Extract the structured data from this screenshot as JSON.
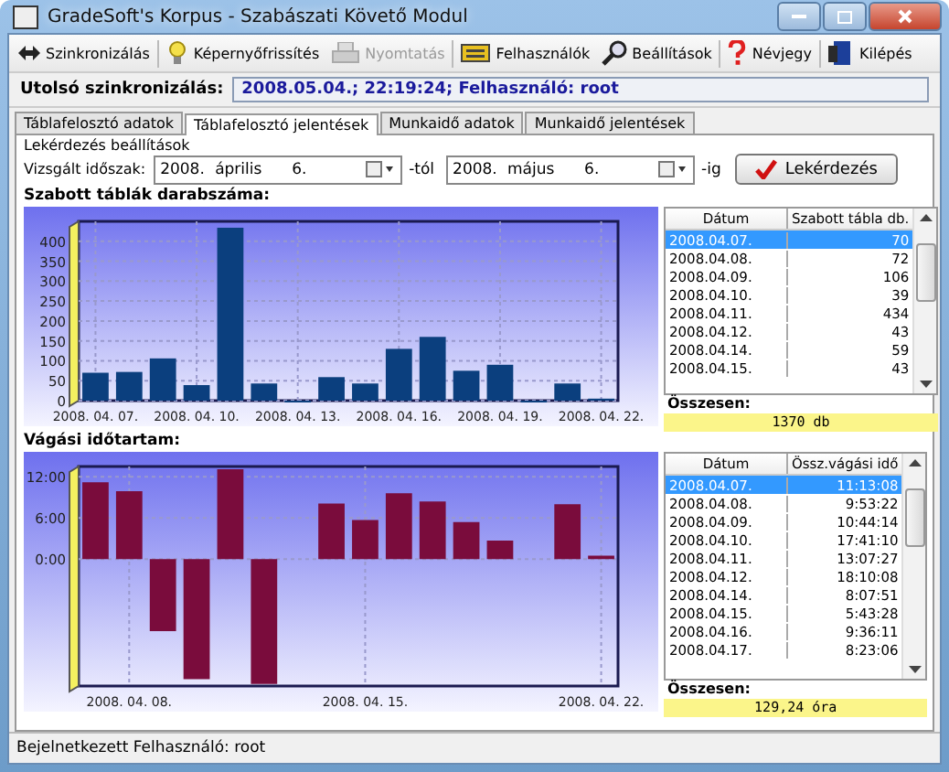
{
  "window": {
    "title": "GradeSoft's Korpus - Szabászati Követő Modul"
  },
  "toolbar": [
    {
      "label": "Szinkronizálás",
      "disabled": false
    },
    {
      "label": "Képernyőfrissítés",
      "disabled": false
    },
    {
      "label": "Nyomtatás",
      "disabled": true
    },
    {
      "label": "Felhasználók",
      "disabled": false
    },
    {
      "label": "Beállítások",
      "disabled": false
    },
    {
      "label": "Névjegy",
      "disabled": false
    },
    {
      "label": "Kilépés",
      "disabled": false
    }
  ],
  "sync": {
    "label": "Utolsó szinkronizálás:",
    "value": "2008.05.04.; 22:19:24; Felhasználó: root"
  },
  "tabs": [
    {
      "label": "Táblafelosztó adatok",
      "selected": false
    },
    {
      "label": "Táblafelosztó jelentések",
      "selected": true
    },
    {
      "label": "Munkaidő adatok",
      "selected": false
    },
    {
      "label": "Munkaidő jelentések",
      "selected": false
    }
  ],
  "query": {
    "group_label": "Lekérdezés beállítások",
    "period_label": "Vizsgált időszak:",
    "from": {
      "year": "2008.",
      "month": "április",
      "day": "6."
    },
    "from_suffix": "-tól",
    "to": {
      "year": "2008.",
      "month": "május",
      "day": "6."
    },
    "to_suffix": "-ig",
    "button": "Lekérdezés"
  },
  "panels": [
    {
      "title": "Szabott táblák darabszáma:",
      "chart_data": {
        "type": "bar",
        "grid": true,
        "categories": [
          "2008. 04. 07.",
          null,
          null,
          "2008. 04. 10.",
          null,
          null,
          "2008. 04. 13.",
          null,
          null,
          "2008. 04. 16.",
          null,
          null,
          "2008. 04. 19.",
          null,
          null,
          "2008. 04. 22."
        ],
        "ylim": [
          0,
          450
        ],
        "yticks": [
          0,
          50,
          100,
          150,
          200,
          250,
          300,
          350,
          400
        ],
        "series": [
          {
            "color": "#0b3f7e",
            "values": [
              70,
              72,
              106,
              39,
              434,
              43,
              0,
              59,
              43,
              130,
              160,
              75,
              90,
              0,
              43,
              5
            ]
          }
        ]
      },
      "table": {
        "columns": [
          "Dátum",
          "Szabott tábla db."
        ],
        "rows": [
          {
            "cells": [
              "2008.04.07.",
              "70"
            ],
            "selected": true
          },
          {
            "cells": [
              "2008.04.08.",
              "72"
            ],
            "selected": false
          },
          {
            "cells": [
              "2008.04.09.",
              "106"
            ],
            "selected": false
          },
          {
            "cells": [
              "2008.04.10.",
              "39"
            ],
            "selected": false
          },
          {
            "cells": [
              "2008.04.11.",
              "434"
            ],
            "selected": false
          },
          {
            "cells": [
              "2008.04.12.",
              "43"
            ],
            "selected": false
          },
          {
            "cells": [
              "2008.04.14.",
              "59"
            ],
            "selected": false
          },
          {
            "cells": [
              "2008.04.15.",
              "43"
            ],
            "selected": false
          }
        ]
      },
      "total_label": "Összesen:",
      "total": "1370 db"
    },
    {
      "title": "Vágási időtartam:",
      "chart_data": {
        "type": "bar",
        "grid": true,
        "categories": [
          null,
          "2008. 04. 08.",
          null,
          null,
          null,
          null,
          null,
          null,
          "2008. 04. 15.",
          null,
          null,
          null,
          null,
          null,
          null,
          "2008. 04. 22."
        ],
        "ylim": [
          -18.5,
          13.5
        ],
        "yticks": [
          {
            "value": 12,
            "label": "12:00"
          },
          {
            "value": 6,
            "label": "6:00"
          },
          {
            "value": 0,
            "label": "0:00"
          }
        ],
        "series": [
          {
            "color": "#7a0c3c",
            "values": [
              11.2,
              9.9,
              -10.5,
              -17.5,
              13.1,
              -18.2,
              null,
              8.1,
              5.7,
              9.6,
              8.4,
              5.4,
              2.7,
              null,
              8,
              0.5
            ]
          }
        ]
      },
      "table": {
        "columns": [
          "Dátum",
          "Össz.vágási idő"
        ],
        "rows": [
          {
            "cells": [
              "2008.04.07.",
              "11:13:08"
            ],
            "selected": true
          },
          {
            "cells": [
              "2008.04.08.",
              "9:53:22"
            ],
            "selected": false
          },
          {
            "cells": [
              "2008.04.09.",
              "10:44:14"
            ],
            "selected": false
          },
          {
            "cells": [
              "2008.04.10.",
              "17:41:10"
            ],
            "selected": false
          },
          {
            "cells": [
              "2008.04.11.",
              "13:07:27"
            ],
            "selected": false
          },
          {
            "cells": [
              "2008.04.12.",
              "18:10:08"
            ],
            "selected": false
          },
          {
            "cells": [
              "2008.04.14.",
              "8:07:51"
            ],
            "selected": false
          },
          {
            "cells": [
              "2008.04.15.",
              "5:43:28"
            ],
            "selected": false
          },
          {
            "cells": [
              "2008.04.16.",
              "9:36:11"
            ],
            "selected": false
          },
          {
            "cells": [
              "2008.04.17.",
              "8:23:06"
            ],
            "selected": false
          }
        ]
      },
      "total_label": "Összesen:",
      "total": "129,24 óra"
    }
  ],
  "status_bar": "Bejelnetkezett Felhasználó: root"
}
